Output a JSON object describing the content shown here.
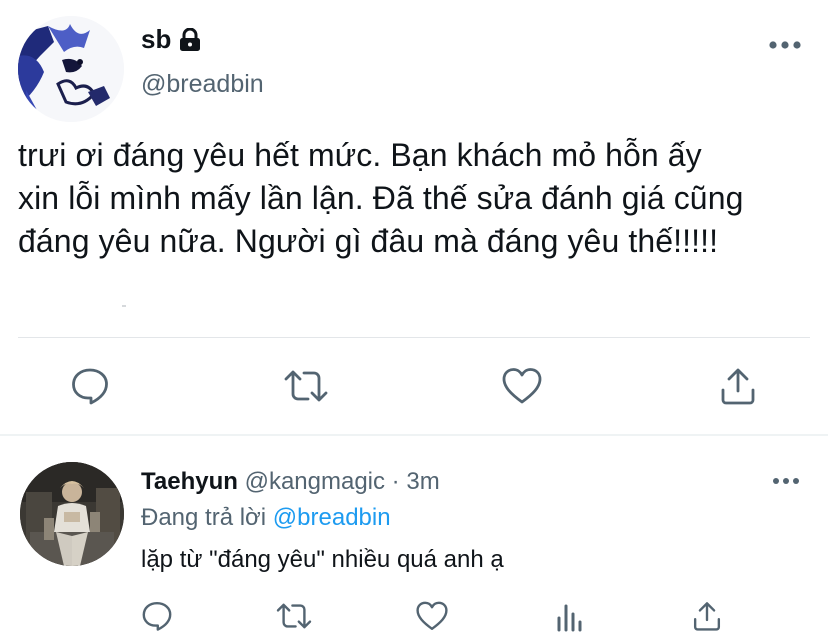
{
  "colors": {
    "text": "#0f1419",
    "secondary": "#536471",
    "link": "#1d9bf0",
    "divider": "#eff3f4"
  },
  "tweet": {
    "author_name": "sb",
    "author_handle": "@breadbin",
    "protected_icon": "lock-icon",
    "text": "trưi ơi đáng yêu hết mức. Bạn khách mỏ hỗn ấy\nxin lỗi mình mấy lần lận. Đã thế sửa đánh giá cũng\nđáng yêu nữa. Người gì đâu mà đáng yêu thế!!!!!",
    "actions": [
      "reply-icon",
      "retweet-icon",
      "like-icon",
      "share-icon"
    ]
  },
  "reply": {
    "author_name": "Taehyun",
    "author_handle": "@kangmagic",
    "separator": " · ",
    "time": "3m",
    "replying_prefix": "Đang trả lời ",
    "replying_handle": "@breadbin",
    "text": "lặp từ \"đáng yêu\" nhiều quá anh ạ",
    "actions": [
      "reply-icon",
      "retweet-icon",
      "like-icon",
      "analytics-icon",
      "share-icon"
    ]
  }
}
